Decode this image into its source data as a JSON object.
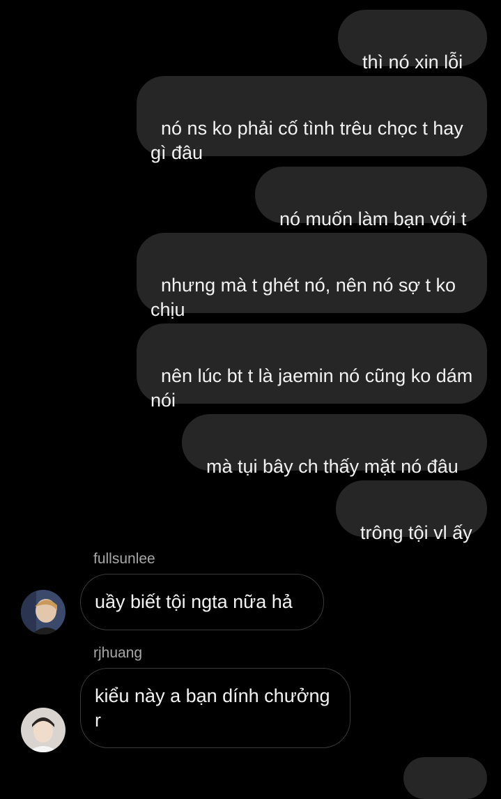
{
  "messages_out": [
    {
      "text": "thì nó xin lỗi t"
    },
    {
      "text": "nó ns ko phải cố tình trêu chọc t hay gì đâu"
    },
    {
      "text": "nó muốn làm bạn với t"
    },
    {
      "text": "nhưng mà t ghét nó, nên nó sợ t ko chịu"
    },
    {
      "text": "nên lúc bt t là jaemin nó cũng ko dám nói"
    },
    {
      "text": "mà tụi bây ch thấy mặt nó đâu"
    },
    {
      "text": "trông tội vl ấy"
    }
  ],
  "messages_in": [
    {
      "sender": "fullsunlee",
      "text": "uầy biết tội ngta nữa hả"
    },
    {
      "sender": "rjhuang",
      "text": "kiểu này a bạn dính chưởng r"
    }
  ],
  "colors": {
    "background": "#000000",
    "outgoing_bubble": "#262626",
    "incoming_border": "#3a3a3a",
    "sender_name": "#a8a8a8"
  }
}
